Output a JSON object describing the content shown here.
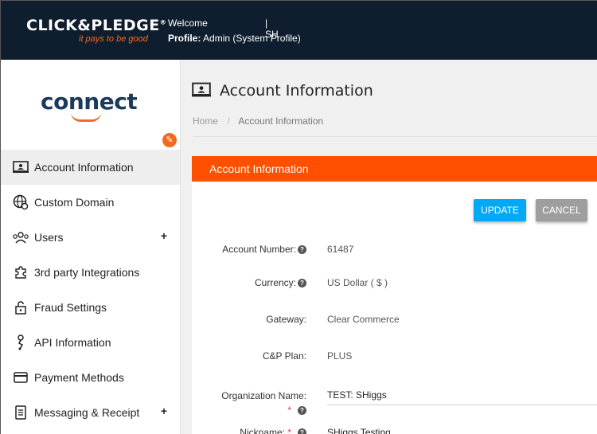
{
  "header": {
    "brand": "CLICK&PLEDGE",
    "tagline": "it pays to be good",
    "welcome_label": "Welcome",
    "welcome_user": "| SH",
    "profile_label": "Profile:",
    "profile_value": "Admin (System Profile)"
  },
  "sidebar": {
    "logo_text": "connect",
    "items": [
      {
        "label": "Account Information",
        "icon": "account-card-icon",
        "active": true
      },
      {
        "label": "Custom Domain",
        "icon": "globe-gear-icon"
      },
      {
        "label": "Users",
        "icon": "users-icon",
        "expand": "+"
      },
      {
        "label": "3rd party Integrations",
        "icon": "puzzle-icon"
      },
      {
        "label": "Fraud Settings",
        "icon": "lock-icon"
      },
      {
        "label": "API Information",
        "icon": "api-icon"
      },
      {
        "label": "Payment Methods",
        "icon": "credit-card-icon"
      },
      {
        "label": "Messaging & Receipt",
        "icon": "receipt-icon",
        "expand": "+"
      }
    ]
  },
  "main": {
    "title": "Account Information",
    "breadcrumb": {
      "home": "Home",
      "separator": "/",
      "current": "Account Information"
    },
    "panel_title": "Account Information",
    "buttons": {
      "update": "UPDATE",
      "cancel": "CANCEL"
    },
    "fields": [
      {
        "label": "Account Number:",
        "value": "61487",
        "help": "?"
      },
      {
        "label": "Currency:",
        "value": "US Dollar ( $ )",
        "help": "?"
      },
      {
        "label": "Gateway:",
        "value": "Clear Commerce"
      },
      {
        "label": "C&P Plan:",
        "value": "PLUS"
      },
      {
        "label": "Organization Name:",
        "value": "TEST: SHiggs",
        "required": "*",
        "help": "?"
      },
      {
        "label": "Nickname:",
        "value": "SHiggs Testing",
        "required": "*",
        "help": "?"
      }
    ]
  },
  "colors": {
    "header_bg": "#0f1e2e",
    "brand_orange": "#fe5000",
    "update_blue": "#03a9f4",
    "cancel_gray": "#9e9e9e"
  }
}
